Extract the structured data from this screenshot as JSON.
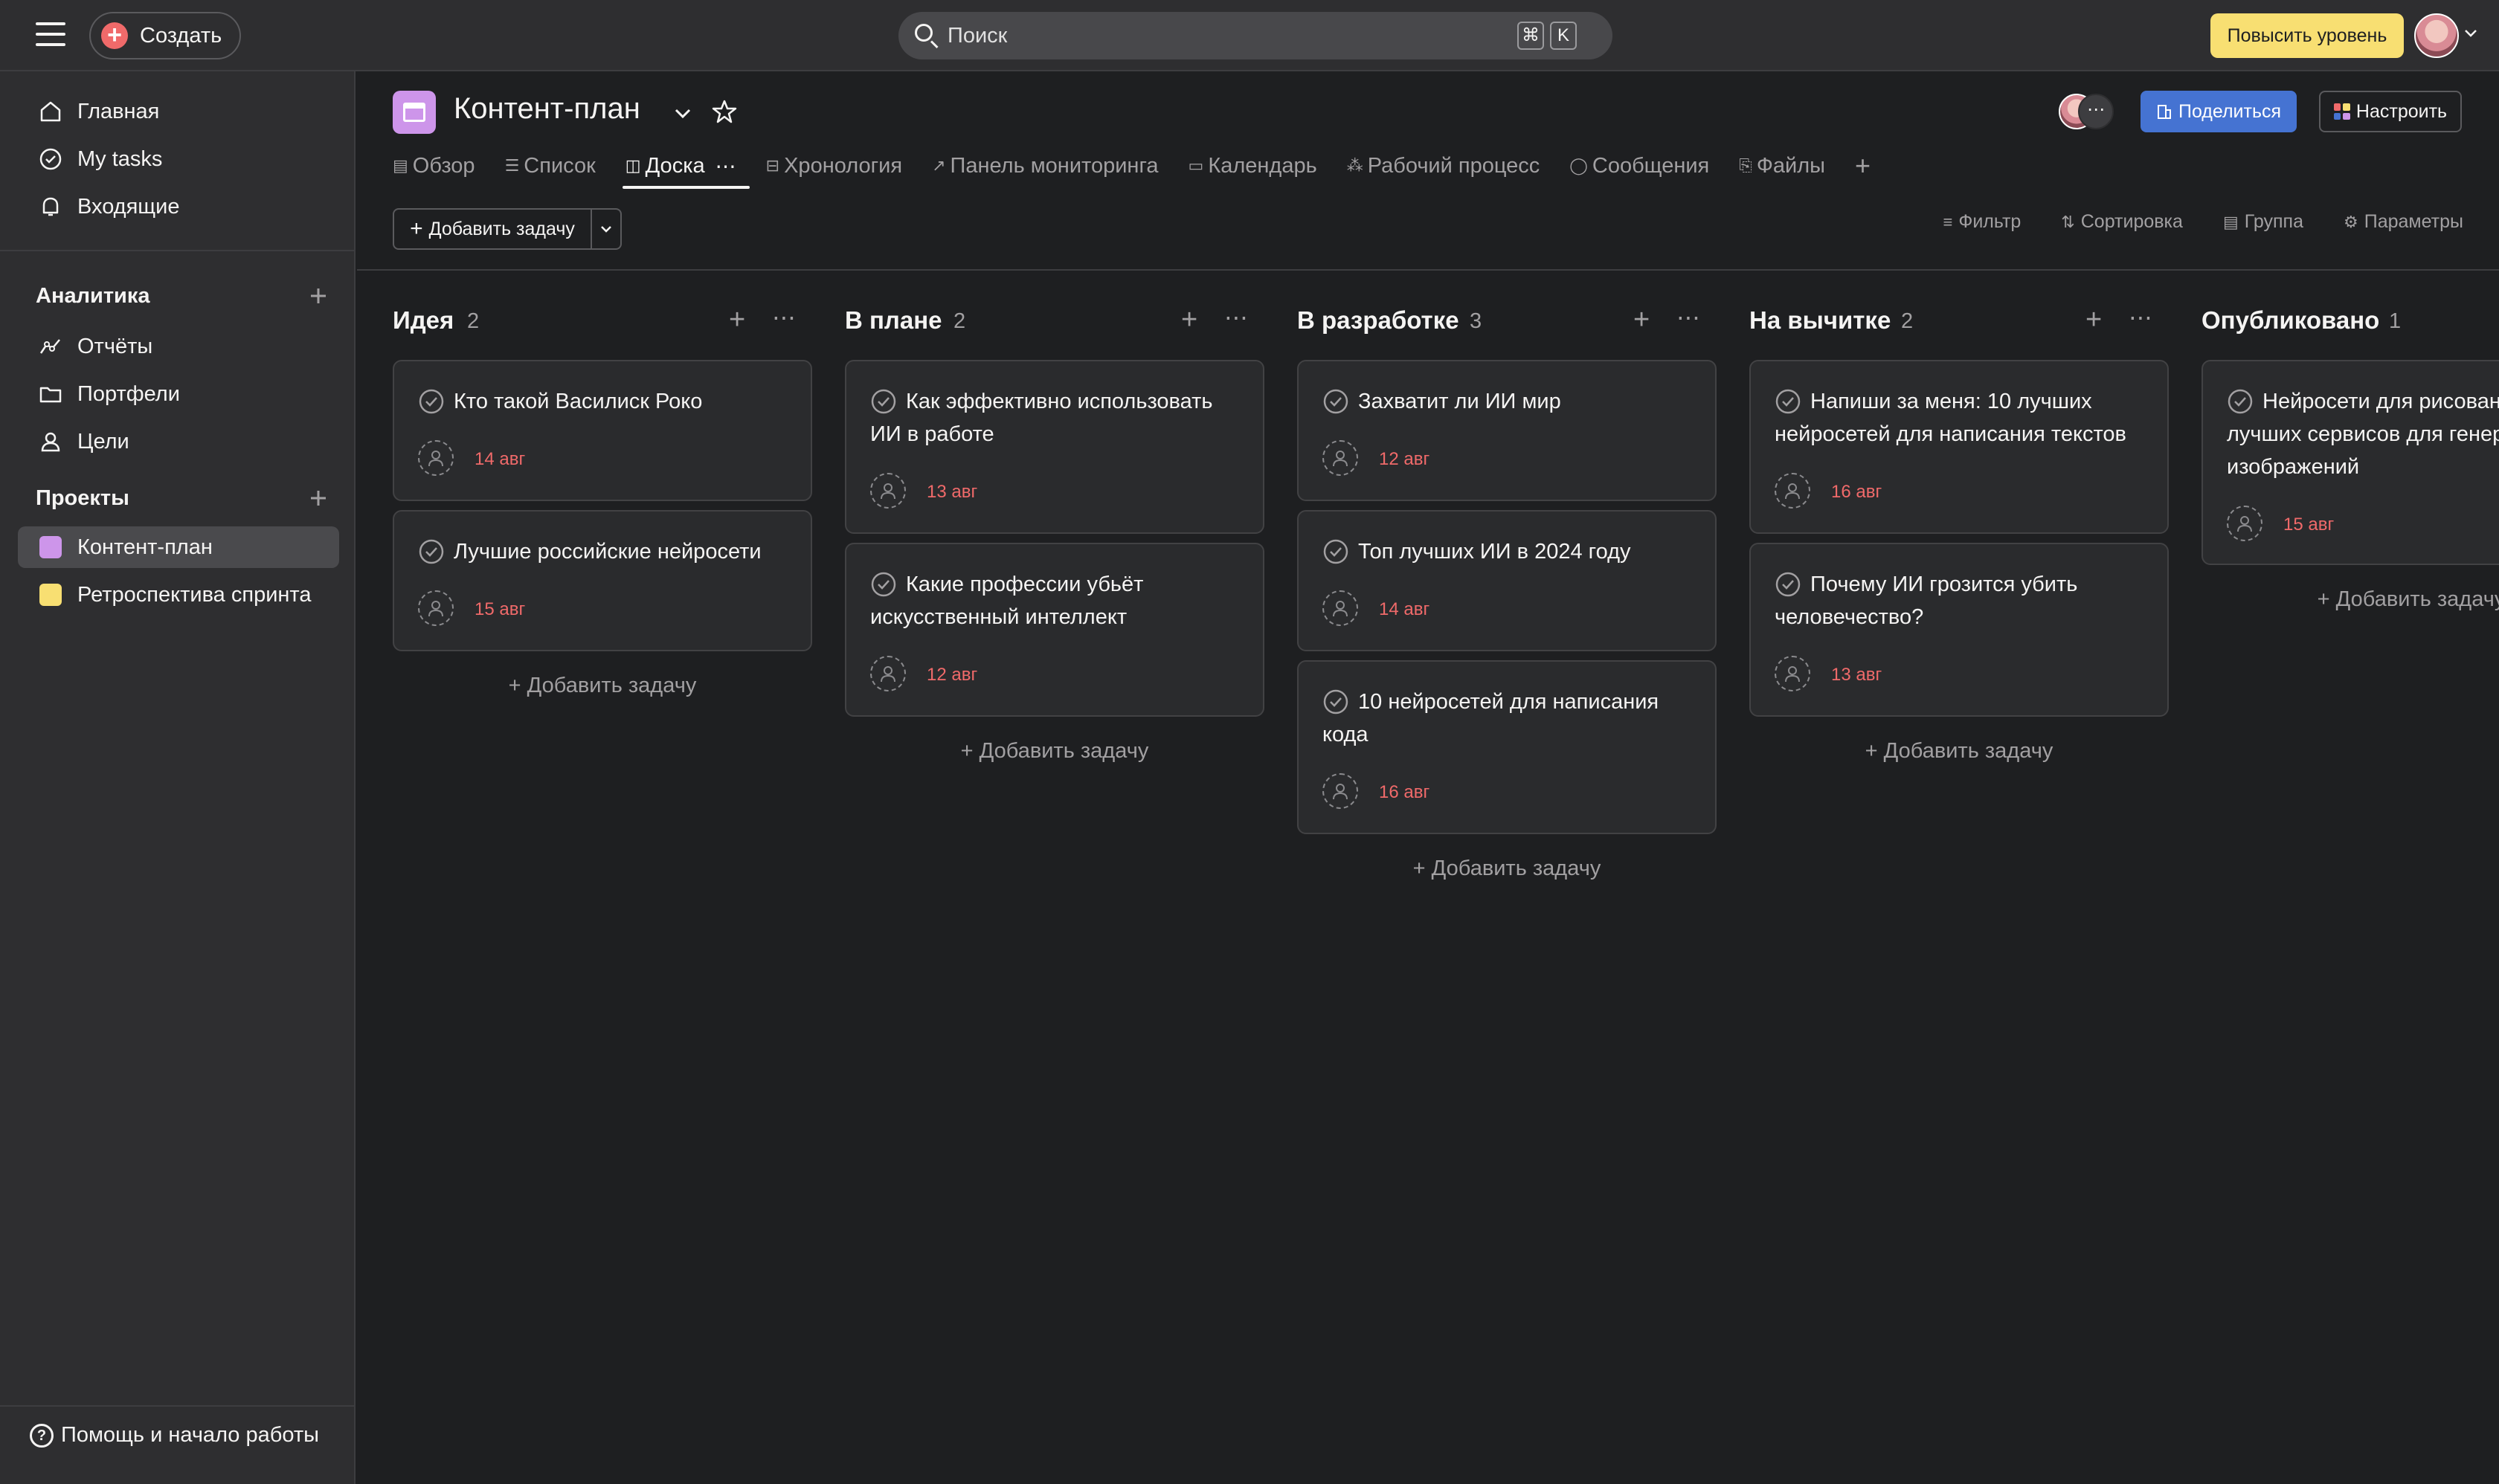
{
  "topbar": {
    "create_label": "Создать",
    "search_placeholder": "Поиск",
    "shortcut_cmd": "⌘",
    "shortcut_key": "K",
    "upgrade_label": "Повысить уровень"
  },
  "sidebar": {
    "nav": [
      {
        "label": "Главная",
        "icon": "home-icon"
      },
      {
        "label": "My tasks",
        "icon": "check-circle-icon"
      },
      {
        "label": "Входящие",
        "icon": "bell-icon"
      }
    ],
    "analytics_title": "Аналитика",
    "analytics": [
      {
        "label": "Отчёты",
        "icon": "chart-line-icon"
      },
      {
        "label": "Портфели",
        "icon": "folder-icon"
      },
      {
        "label": "Цели",
        "icon": "person-icon"
      }
    ],
    "projects_title": "Проекты",
    "projects": [
      {
        "label": "Контент-план",
        "color": "#cd95ea"
      },
      {
        "label": "Ретроспектива спринта",
        "color": "#f8df72"
      }
    ],
    "help_label": "Помощь и начало работы"
  },
  "project": {
    "title": "Контент-план",
    "share_label": "Поделиться",
    "customize_label": "Настроить",
    "tabs": [
      {
        "label": "Обзор",
        "icon": "▤"
      },
      {
        "label": "Список",
        "icon": "☰"
      },
      {
        "label": "Доска",
        "icon": "◫"
      },
      {
        "label": "Хронология",
        "icon": "⊟"
      },
      {
        "label": "Панель мониторинга",
        "icon": "↗"
      },
      {
        "label": "Календарь",
        "icon": "▭"
      },
      {
        "label": "Рабочий процесс",
        "icon": "⁂"
      },
      {
        "label": "Сообщения",
        "icon": "◯"
      },
      {
        "label": "Файлы",
        "icon": "⎘"
      }
    ],
    "add_task_label": "Добавить задачу",
    "view_actions": [
      {
        "label": "Фильтр",
        "icon": "≡"
      },
      {
        "label": "Сортировка",
        "icon": "⇅"
      },
      {
        "label": "Группа",
        "icon": "▤"
      },
      {
        "label": "Параметры",
        "icon": "⚙"
      }
    ]
  },
  "board": {
    "add_task_label": "+ Добавить задачу",
    "columns": [
      {
        "title": "Идея",
        "count": "2",
        "cards": [
          {
            "title": "Кто такой Василиск Роко",
            "date": "14 авг"
          },
          {
            "title": "Лучшие российские нейросети",
            "date": "15 авг"
          }
        ]
      },
      {
        "title": "В плане",
        "count": "2",
        "cards": [
          {
            "title": "Как эффективно использовать ИИ в работе",
            "date": "13 авг"
          },
          {
            "title": "Какие профессии убьёт искусственный интеллект",
            "date": "12 авг"
          }
        ]
      },
      {
        "title": "В разработке",
        "count": "3",
        "cards": [
          {
            "title": "Захватит ли ИИ мир",
            "date": "12 авг"
          },
          {
            "title": "Топ лучших ИИ в 2024 году",
            "date": "14 авг"
          },
          {
            "title": "10 нейросетей для написания кода",
            "date": "16 авг"
          }
        ]
      },
      {
        "title": "На вычитке",
        "count": "2",
        "cards": [
          {
            "title": "Напиши за меня: 10 лучших нейросетей для написания текстов",
            "date": "16 авг"
          },
          {
            "title": "Почему ИИ грозится убить человечество?",
            "date": "13 авг"
          }
        ]
      },
      {
        "title": "Опубликовано",
        "count": "1",
        "cards": [
          {
            "title": "Нейросети для рисования: лучших сервисов для генерации изображений",
            "date": "15 авг"
          }
        ]
      }
    ]
  },
  "colors": {
    "background": "#1e1f21",
    "panel": "#2e2e30",
    "accent_blue": "#4573d2",
    "due_red": "#f06a6a",
    "upgrade_yellow": "#f8df72"
  }
}
